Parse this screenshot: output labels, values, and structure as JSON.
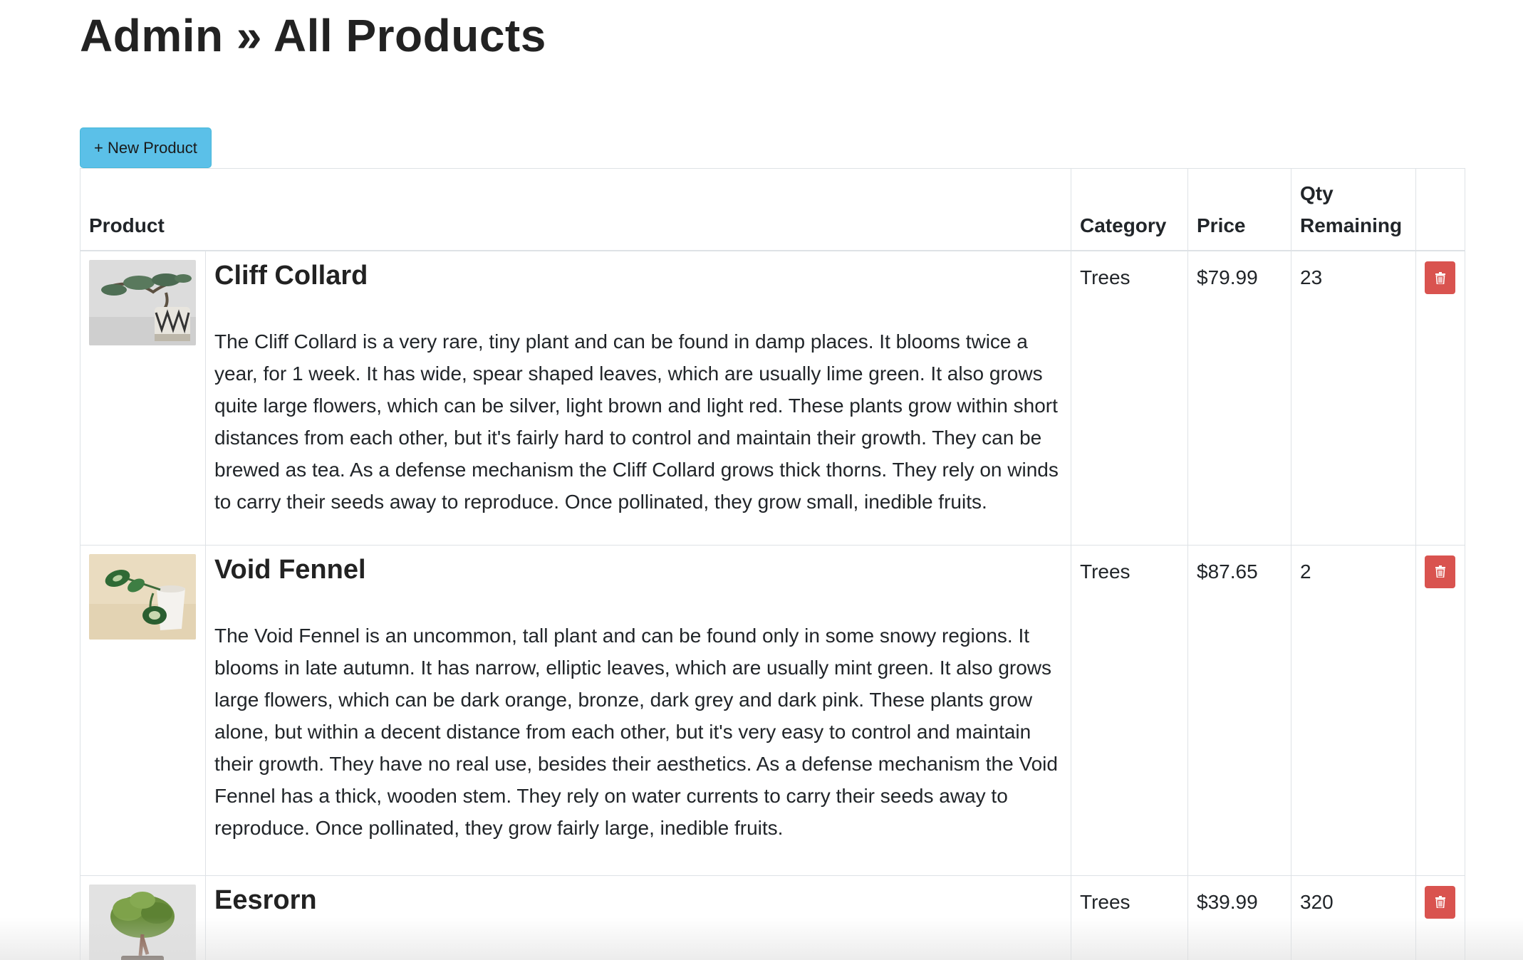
{
  "header": {
    "title": "Admin » All Products"
  },
  "toolbar": {
    "new_product_label": "+ New Product"
  },
  "table": {
    "headers": {
      "product": "Product",
      "category": "Category",
      "price": "Price",
      "qty": "Qty Remaining"
    },
    "rows": [
      {
        "name": "Cliff Collard",
        "description": "The Cliff Collard is a very rare, tiny plant and can be found in damp places. It blooms twice a year, for 1 week. It has wide, spear shaped leaves, which are usually lime green. It also grows quite large flowers, which can be silver, light brown and light red. These plants grow within short distances from each other, but it's fairly hard to control and maintain their growth. They can be brewed as tea. As a defense mechanism the Cliff Collard grows thick thorns. They rely on winds to carry their seeds away to reproduce. Once pollinated, they grow small, inedible fruits.",
        "category": "Trees",
        "price": "$79.99",
        "qty": "23",
        "image_icon": "bonsai-juniper-image"
      },
      {
        "name": "Void Fennel",
        "description": "The Void Fennel is an uncommon, tall plant and can be found only in some snowy regions. It blooms in late autumn. It has narrow, elliptic leaves, which are usually mint green. It also grows large flowers, which can be dark orange, bronze, dark grey and dark pink. These plants grow alone, but within a decent distance from each other, but it's very easy to control and maintain their growth. They have no real use, besides their aesthetics. As a defense mechanism the Void Fennel has a thick, wooden stem. They rely on water currents to carry their seeds away to reproduce. Once pollinated, they grow fairly large, inedible fruits.",
        "category": "Trees",
        "price": "$87.65",
        "qty": "2",
        "image_icon": "potted-vine-image"
      },
      {
        "name": "Eesrorn",
        "description": "",
        "category": "Trees",
        "price": "$39.99",
        "qty": "320",
        "image_icon": "bonsai-tree-image"
      }
    ]
  },
  "colors": {
    "new_button_bg": "#5bc0e8",
    "delete_button_bg": "#d9534f",
    "border": "#dee2e6"
  },
  "icons": {
    "delete": "trash-icon"
  }
}
